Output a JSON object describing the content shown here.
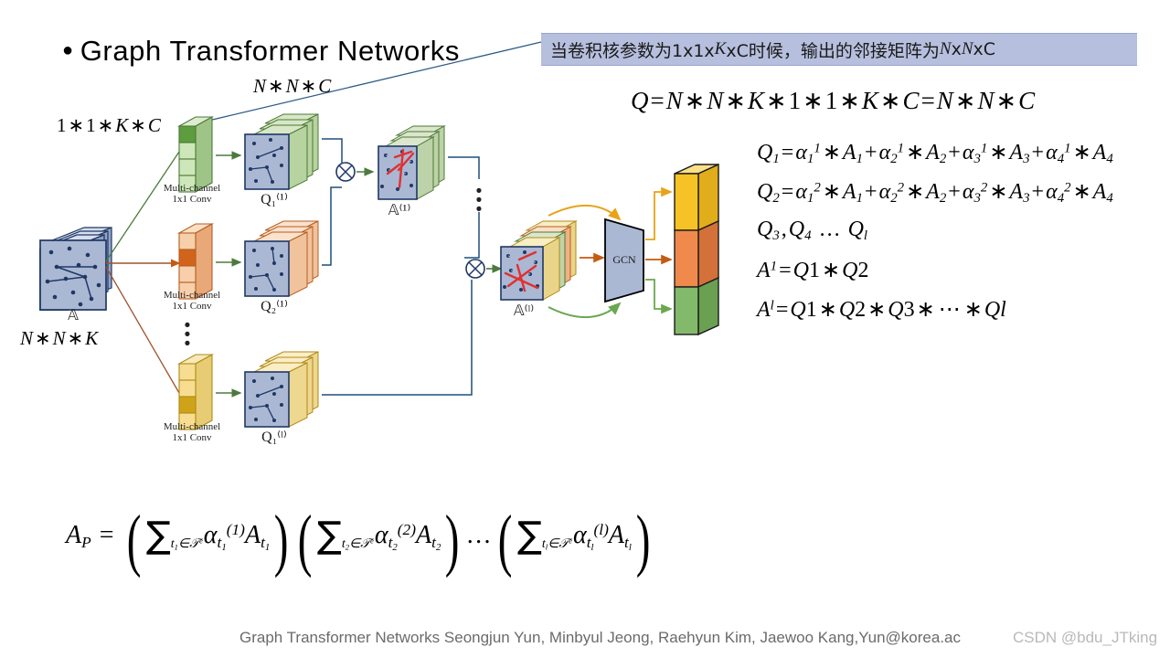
{
  "title": {
    "bullet": "●",
    "text": "Graph Transformer Networks"
  },
  "callout": {
    "prefix": "当卷积核参数为1x1x",
    "italic1": "K",
    "middle": "xC时候，输出的邻接矩阵为",
    "italic2": "N",
    "mid2": "x",
    "italic3": "N",
    "suffix": "xC"
  },
  "equations": {
    "q_main": "Q = N * N * K * 1 * 1 * K * C = N * N * C",
    "rows": [
      "Q₁ = α₁¹ * A₁ + α₂¹ * A₂ + α₃¹ * A₃ + α₄¹ * A₄",
      "Q₂ = α₁² * A₁ + α₂² * A₂ + α₃² * A₃ + α₄² * A₄",
      "Q₃, Q₄ … Q_l",
      "A¹ = Q1 * Q2",
      "A^l = Q1 * Q2 * Q3 * ⋯ * Ql"
    ],
    "big_formula": "A_P = ( Σ_{t₁∈𝒯ᵉ} α_{t₁}^{(1)} A_{t₁} )( Σ_{t₂∈𝒯ᵉ} α_{t₂}^{(2)} A_{t₂} ) … ( Σ_{t_l∈𝒯ᵉ} α_{t_l}^{(l)} A_{t_l} )"
  },
  "diagram": {
    "label_nnc": "N * N * C",
    "label_11kc": "1 * 1 * K * C",
    "label_nnk": "N * N * K",
    "input_cube_label": "𝔸",
    "conv_caption_line1": "Multi-channel",
    "conv_caption_line2": "1x1 Conv",
    "q_labels": [
      "Q₁⁽¹⁾",
      "Q₂⁽¹⁾",
      "Q₁⁽ˡ⁾"
    ],
    "a1_label": "𝔸⁽¹⁾",
    "al_label": "𝔸⁽ˡ⁾",
    "gcn_label": "GCN",
    "multiply_symbol": "⊗",
    "vertical_dots": "⋮"
  },
  "footer": {
    "citation": "Graph Transformer Networks Seongjun Yun, Minbyul Jeong, Raehyun Kim, Jaewoo Kang,",
    "email": "Yun@korea.ac",
    "watermark": "CSDN @bdu_JTking"
  },
  "colors": {
    "callout_bg": "#b6bfdd",
    "blue_face": "#aab8d4",
    "blue_edge": "#1f3864",
    "green_face": "#c6dfb7",
    "green_edge": "#4d7a35",
    "orange_face": "#f6c9a2",
    "orange_edge": "#b75d20",
    "yellow_face": "#f6dc96",
    "yellow_edge": "#b08a18",
    "out_yellow": "#f5c325",
    "out_orange": "#ef8a4c",
    "out_green": "#82b96a",
    "red_edge": "#e03131",
    "arrow_green": "#4c7a3e",
    "arrow_orange": "#c55a11",
    "arrow_blue": "#1f4e79"
  }
}
